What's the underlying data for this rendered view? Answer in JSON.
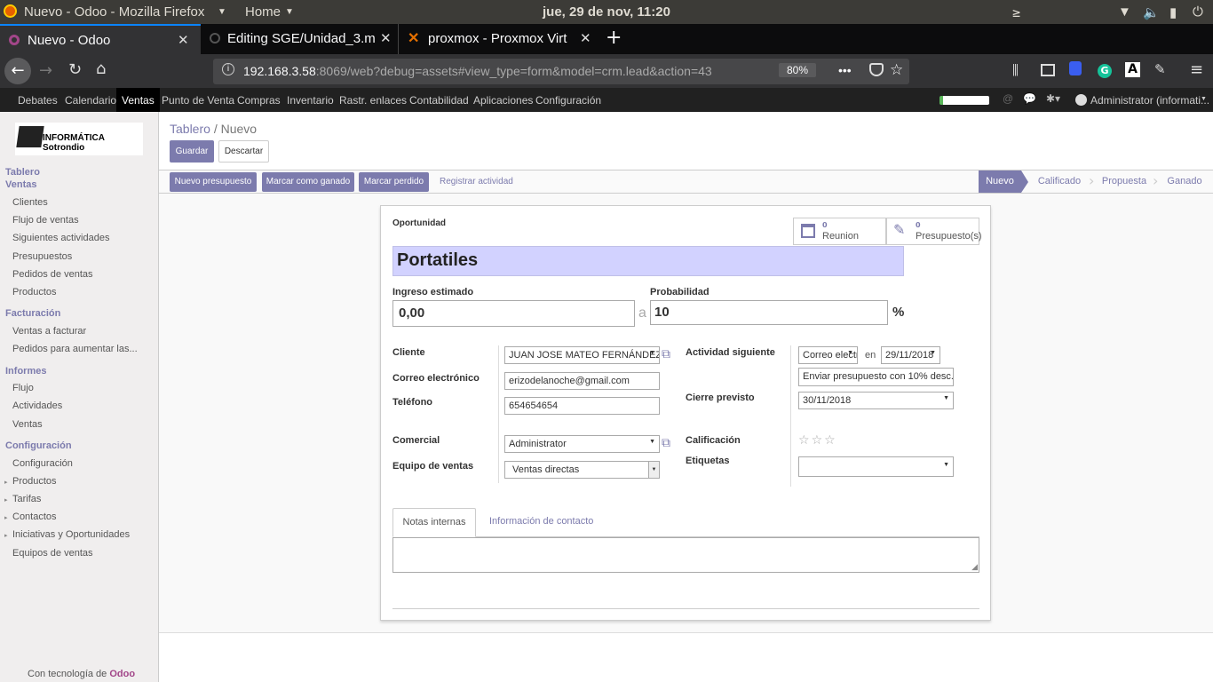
{
  "os": {
    "app_title": "Nuevo - Odoo - Mozilla Firefox",
    "home": "Home",
    "clock": "jue, 29 de nov, 11:20"
  },
  "tabs": [
    {
      "label": "Nuevo - Odoo"
    },
    {
      "label": "Editing SGE/Unidad_3.m"
    },
    {
      "label": "proxmox - Proxmox Virt"
    }
  ],
  "browser": {
    "url_host": "192.168.3.58",
    "url_rest": ":8069/web?debug=assets#view_type=form&model=crm.lead&action=43",
    "zoom": "80%"
  },
  "odoo_menu": {
    "items": [
      "Debates",
      "Calendario",
      "Ventas",
      "Punto de Venta",
      "Compras",
      "Inventario",
      "Rastr. enlaces",
      "Contabilidad",
      "Aplicaciones",
      "Configuración"
    ],
    "active": "Ventas",
    "user": "Administrator (informati..."
  },
  "sidebar": {
    "logo_text": "INFORMÁTICA Sotrondio",
    "tablero": "Tablero",
    "ventas": "Ventas",
    "ventas_items": [
      "Clientes",
      "Flujo de ventas",
      "Siguientes actividades",
      "Presupuestos",
      "Pedidos de ventas",
      "Productos"
    ],
    "facturacion": "Facturación",
    "facturacion_items": [
      "Ventas a facturar",
      "Pedidos para aumentar las..."
    ],
    "informes": "Informes",
    "informes_items": [
      "Flujo",
      "Actividades",
      "Ventas"
    ],
    "configuracion": "Configuración",
    "config_items": [
      "Configuración",
      "Productos",
      "Tarifas",
      "Contactos",
      "Iniciativas y Oportunidades",
      "Equipos de ventas"
    ],
    "footer_prefix": "Con tecnología de ",
    "footer_brand": "Odoo"
  },
  "breadcrumb": {
    "root": "Tablero",
    "sep": "/",
    "current": "Nuevo"
  },
  "buttons": {
    "save": "Guardar",
    "discard": "Descartar"
  },
  "actions": {
    "new_quote": "Nuevo presupuesto",
    "won": "Marcar como ganado",
    "lost": "Marcar perdido",
    "activity": "Registrar actividad"
  },
  "stages": [
    "Nuevo",
    "Calificado",
    "Propuesta",
    "Ganado"
  ],
  "active_stage": "Nuevo",
  "smart_buttons": [
    {
      "count": "0",
      "label": "Reunion"
    },
    {
      "count": "0",
      "label": "Presupuesto(s)"
    }
  ],
  "form": {
    "type_label": "Oportunidad",
    "name": "Portatiles",
    "revenue_label": "Ingreso estimado",
    "revenue": "0,00",
    "at": "a",
    "prob_label": "Probabilidad",
    "prob": "10",
    "percent": "%",
    "cliente_label": "Cliente",
    "cliente": "JUAN JOSE MATEO FERNÁNDEZ",
    "email_label": "Correo electrónico",
    "email": "erizodelanoche@gmail.com",
    "phone_label": "Teléfono",
    "phone": "654654654",
    "next_label": "Actividad siguiente",
    "next_type": "Correo electrónico",
    "en": "en",
    "next_date": "29/11/2018",
    "next_summary": "Enviar presupuesto con 10% desc.",
    "close_label": "Cierre previsto",
    "close_date": "30/11/2018",
    "comercial_label": "Comercial",
    "comercial": "Administrator",
    "team_label": "Equipo de ventas",
    "team": "Ventas directas",
    "rating_label": "Calificación",
    "rating": 0,
    "tags_label": "Etiquetas",
    "tags": ""
  },
  "notebook": {
    "tabs": [
      "Notas internas",
      "Información de contacto"
    ],
    "active": "Notas internas"
  }
}
